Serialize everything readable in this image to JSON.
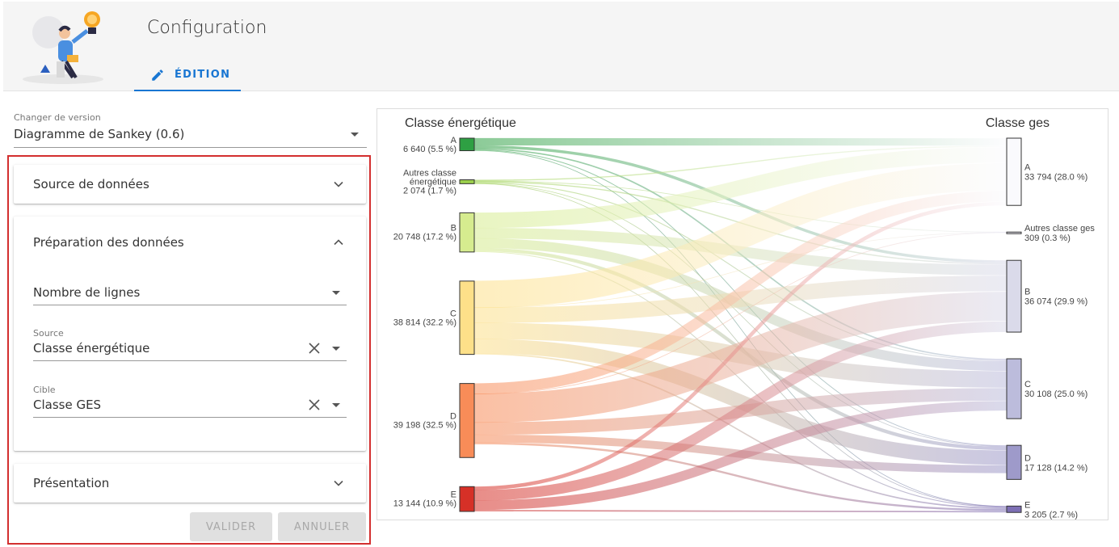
{
  "header": {
    "title": "Configuration",
    "tab_edit": "ÉDITION"
  },
  "version": {
    "label": "Changer de version",
    "value": "Diagramme de Sankey (0.6)"
  },
  "sections": {
    "source": "Source de données",
    "preparation": "Préparation des données",
    "presentation": "Présentation"
  },
  "preparation": {
    "rows_value": "Nombre de lignes",
    "source_label": "Source",
    "source_value": "Classe énergétique",
    "target_label": "Cible",
    "target_value": "Classe GES"
  },
  "buttons": {
    "validate": "VALIDER",
    "cancel": "ANNULER"
  },
  "chart_data": {
    "type": "sankey",
    "left_title": "Classe énergétique",
    "right_title": "Classe ges",
    "source_nodes": [
      {
        "name": "A",
        "value_label": "6 640 (5.5 %)",
        "value": 6640,
        "color": "#2ea043"
      },
      {
        "name": "Autres classe énergétique",
        "value_label": "2 074 (1.7 %)",
        "value": 2074,
        "color": "#9bd04c"
      },
      {
        "name": "B",
        "value_label": "20 748 (17.2 %)",
        "value": 20748,
        "color": "#d6ec8f"
      },
      {
        "name": "C",
        "value_label": "38 814 (32.2 %)",
        "value": 38814,
        "color": "#fde089"
      },
      {
        "name": "D",
        "value_label": "39 198 (32.5 %)",
        "value": 39198,
        "color": "#f88c58"
      },
      {
        "name": "E",
        "value_label": "13 144 (10.9 %)",
        "value": 13144,
        "color": "#d63027"
      }
    ],
    "target_nodes": [
      {
        "name": "A",
        "value_label": "33 794 (28.0 %)",
        "value": 33794,
        "color": "#fafafd"
      },
      {
        "name": "Autres classe ges",
        "value_label": "309 (0.3 %)",
        "value": 309,
        "color": "#e8e7f2"
      },
      {
        "name": "B",
        "value_label": "36 074 (29.9 %)",
        "value": 36074,
        "color": "#dadaea"
      },
      {
        "name": "C",
        "value_label": "30 108 (25.0 %)",
        "value": 30108,
        "color": "#bcbcdc"
      },
      {
        "name": "D",
        "value_label": "17 128 (14.2 %)",
        "value": 17128,
        "color": "#9e9aca"
      },
      {
        "name": "E",
        "value_label": "3 205 (2.7 %)",
        "value": 3205,
        "color": "#7d6fb4"
      }
    ],
    "links": [
      {
        "source": 0,
        "target": 0,
        "value": 3800
      },
      {
        "source": 0,
        "target": 2,
        "value": 1500
      },
      {
        "source": 0,
        "target": 3,
        "value": 700
      },
      {
        "source": 0,
        "target": 4,
        "value": 400
      },
      {
        "source": 0,
        "target": 5,
        "value": 240
      },
      {
        "source": 1,
        "target": 0,
        "value": 600
      },
      {
        "source": 1,
        "target": 1,
        "value": 100
      },
      {
        "source": 1,
        "target": 2,
        "value": 600
      },
      {
        "source": 1,
        "target": 3,
        "value": 450
      },
      {
        "source": 1,
        "target": 4,
        "value": 250
      },
      {
        "source": 1,
        "target": 5,
        "value": 74
      },
      {
        "source": 2,
        "target": 0,
        "value": 8000
      },
      {
        "source": 2,
        "target": 2,
        "value": 5500
      },
      {
        "source": 2,
        "target": 3,
        "value": 5000
      },
      {
        "source": 2,
        "target": 4,
        "value": 1800
      },
      {
        "source": 2,
        "target": 5,
        "value": 448
      },
      {
        "source": 3,
        "target": 0,
        "value": 14000
      },
      {
        "source": 3,
        "target": 1,
        "value": 109
      },
      {
        "source": 3,
        "target": 2,
        "value": 8000
      },
      {
        "source": 3,
        "target": 3,
        "value": 8500
      },
      {
        "source": 3,
        "target": 4,
        "value": 7500
      },
      {
        "source": 3,
        "target": 5,
        "value": 705
      },
      {
        "source": 4,
        "target": 0,
        "value": 5500
      },
      {
        "source": 4,
        "target": 1,
        "value": 100
      },
      {
        "source": 4,
        "target": 2,
        "value": 15000
      },
      {
        "source": 4,
        "target": 3,
        "value": 6500
      },
      {
        "source": 4,
        "target": 4,
        "value": 4098
      },
      {
        "source": 4,
        "target": 5,
        "value": 1000
      },
      {
        "source": 5,
        "target": 0,
        "value": 1894
      },
      {
        "source": 5,
        "target": 2,
        "value": 5474
      },
      {
        "source": 5,
        "target": 3,
        "value": 4958
      },
      {
        "source": 5,
        "target": 5,
        "value": 738
      }
    ]
  }
}
